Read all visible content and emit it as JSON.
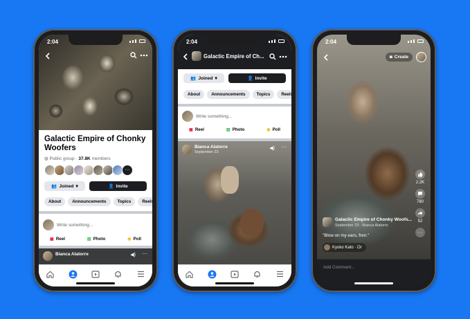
{
  "status_time": "2:04",
  "phone1": {
    "group_name": "Galactic Empire of Chonky Woofers",
    "privacy": "Public group",
    "members_count": "37.8K",
    "members_label": "members",
    "joined_label": "Joined",
    "invite_label": "Invite",
    "chips": [
      "About",
      "Announcements",
      "Topics",
      "Reels"
    ],
    "composer_placeholder": "Write something...",
    "actions": {
      "reel": "Reel",
      "photo": "Photo",
      "poll": "Poll"
    },
    "post_author": "Bianca Alatorre"
  },
  "phone2": {
    "header_title": "Galactic Empire of Ch...",
    "joined_label": "Joined",
    "invite_label": "Invite",
    "chips": [
      "About",
      "Announcements",
      "Topics",
      "Reels"
    ],
    "composer_placeholder": "Write something...",
    "actions": {
      "reel": "Reel",
      "photo": "Photo",
      "poll": "Poll"
    },
    "post_author": "Bianca Alatorre",
    "post_subtitle": "September 23"
  },
  "phone3": {
    "create_label": "Create",
    "like_count": "2.2K",
    "comment_count": "780",
    "share_count": "52",
    "group_name": "Galactic Empire of Chonky Woofs...",
    "post_meta": "September 23 · Bianca Alatorre",
    "caption": "\"Blow on my ears, fren.\"",
    "audio_label": "Kyoko Kato · Or",
    "comment_placeholder": "Add Comment..."
  }
}
